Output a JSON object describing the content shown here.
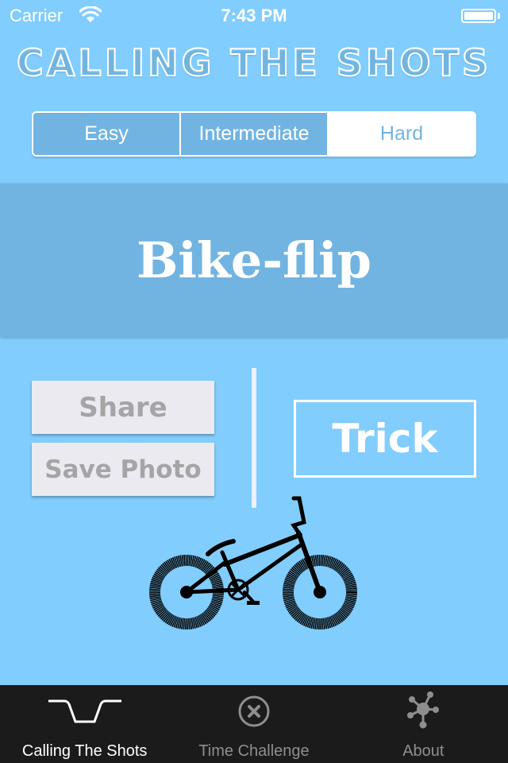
{
  "status_bar": {
    "carrier": "Carrier",
    "time": "7:43 PM",
    "wifi_icon": "wifi-icon",
    "battery_icon": "battery-full-icon"
  },
  "app_title": "CALLING THE SHOTS",
  "difficulty": {
    "options": [
      {
        "label": "Easy",
        "selected": false
      },
      {
        "label": "Intermediate",
        "selected": false
      },
      {
        "label": "Hard",
        "selected": true
      }
    ],
    "selected": "Hard"
  },
  "current_trick": "Bike-flip",
  "actions": {
    "share_label": "Share",
    "save_photo_label": "Save Photo",
    "trick_label": "Trick"
  },
  "illustration": "bmx-bike-icon",
  "tab_bar": {
    "tabs": [
      {
        "label": "Calling The Shots",
        "icon": "handlebar-icon",
        "active": true
      },
      {
        "label": "Time Challenge",
        "icon": "circle-x-icon",
        "active": false
      },
      {
        "label": "About",
        "icon": "network-icon",
        "active": false
      }
    ]
  },
  "colors": {
    "background": "#81CDFD",
    "accent": "#72B4E1",
    "button_bg": "#EBEAF0",
    "button_text": "#A5A5A5",
    "tab_bar": "#1B1B1B"
  }
}
